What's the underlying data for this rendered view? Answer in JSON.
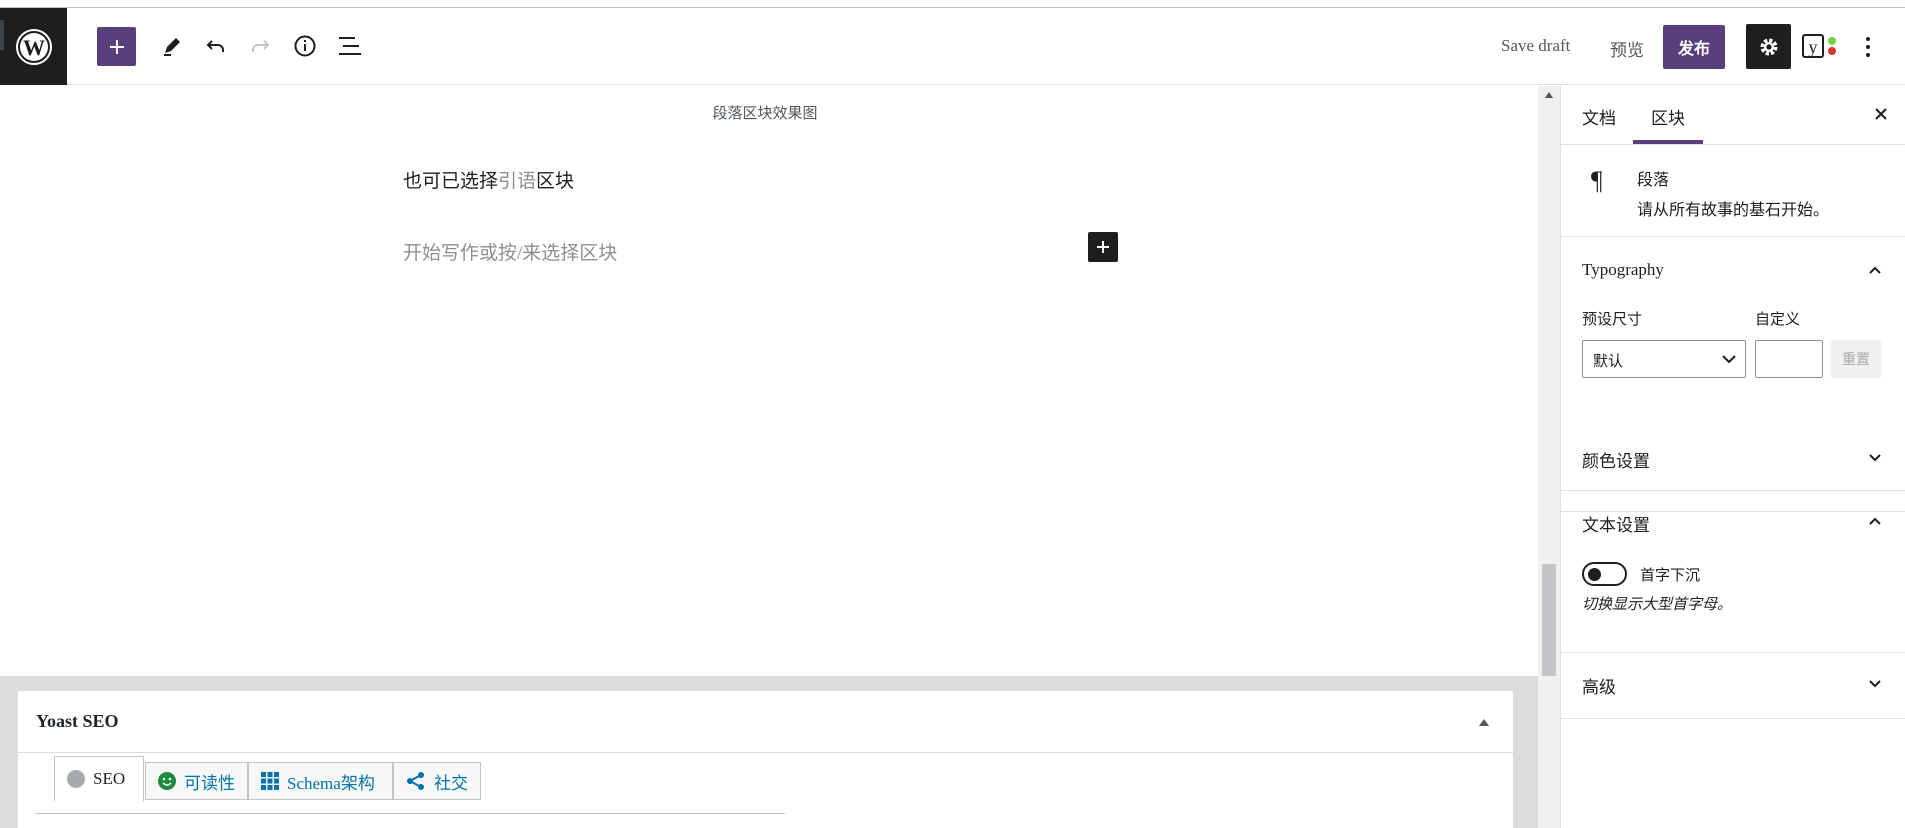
{
  "header": {
    "save_draft": "Save draft",
    "preview": "预览",
    "publish": "发布",
    "icons": [
      "wordpress-logo",
      "plus",
      "pencil",
      "undo",
      "redo",
      "info",
      "list-view",
      "gear",
      "yoast",
      "more-vertical"
    ]
  },
  "editor": {
    "caption": "段落区块效果图",
    "paragraph_parts": [
      "也可已选择",
      "引语",
      "区块"
    ],
    "placeholder": "开始写作或按/来选择区块"
  },
  "metabox": {
    "title": "Yoast SEO",
    "tabs": [
      {
        "label": "SEO",
        "icon": "grey-circle"
      },
      {
        "label": "可读性",
        "icon": "green-smiley"
      },
      {
        "label": "Schema架构",
        "icon": "grid"
      },
      {
        "label": "社交",
        "icon": "share"
      }
    ]
  },
  "sidebar": {
    "tabs": [
      "文档",
      "区块"
    ],
    "active_tab": "区块",
    "block": {
      "icon": "¶",
      "name": "段落",
      "description": "请从所有故事的基石开始。"
    },
    "typography": {
      "title": "Typography",
      "preset_label": "预设尺寸",
      "custom_label": "自定义",
      "preset_value": "默认",
      "reset": "重置"
    },
    "color_settings": "颜色设置",
    "text_settings": {
      "title": "文本设置",
      "drop_cap_label": "首字下沉",
      "drop_cap_help": "切换显示大型首字母。"
    },
    "advanced": "高级"
  },
  "colors": {
    "accent": "#5b3e7c",
    "dark": "#1e1e1e",
    "link": "#0073aa",
    "yoast_green": "#1e8c3e"
  }
}
